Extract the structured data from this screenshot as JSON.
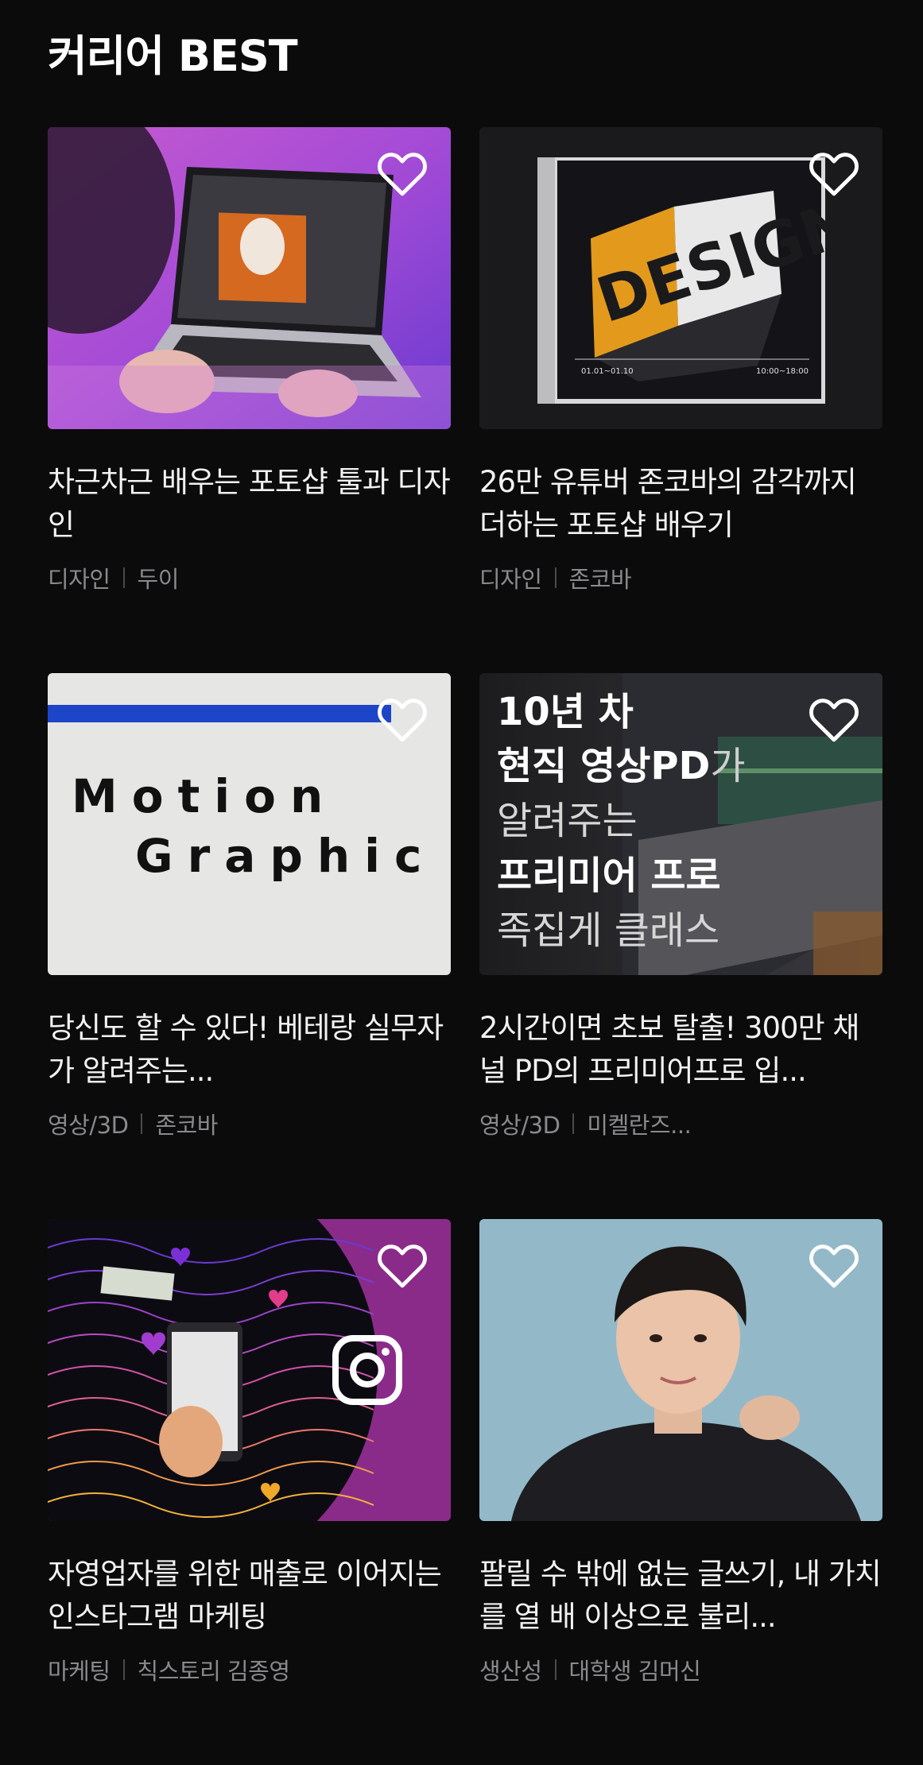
{
  "section": {
    "title": "커리어 BEST"
  },
  "cards": [
    {
      "title": "차근차근 배우는 포토샵 툴과 디자인",
      "category": "디자인",
      "author": "두이",
      "icon": "heart-outline-icon"
    },
    {
      "title": "26만 유튜버 존코바의 감각까지 더하는 포토샵 배우기",
      "category": "디자인",
      "author": "존코바",
      "icon": "heart-outline-icon",
      "cover": {
        "word": "DESIGN",
        "left_text": "01.01~01.10",
        "right_text": "10:00~18:00",
        "accent": "#e39a1c"
      }
    },
    {
      "title": "당신도 할 수 있다! 베테랑 실무자가 알려주는...",
      "category": "영상/3D",
      "author": "존코바",
      "icon": "heart-outline-icon",
      "cover": {
        "line1": "Motion",
        "line2": "Graphic",
        "bar_color": "#1d45c8"
      }
    },
    {
      "title": "2시간이면 초보 탈출! 300만 채널 PD의 프리미어프로 입...",
      "category": "영상/3D",
      "author": "미켈란즈...",
      "icon": "heart-outline-icon",
      "cover": {
        "line1": "10년 차",
        "line2_bold": "현직 영상PD",
        "line2_light": "가",
        "line3": "알려주는",
        "line4": "프리미어 프로",
        "line5": "족집게 클래스"
      }
    },
    {
      "title": "자영업자를 위한 매출로 이어지는 인스타그램 마케팅",
      "category": "마케팅",
      "author": "칙스토리 김종영",
      "icon": "heart-outline-icon",
      "cover": {
        "accent": "#8a2b8a"
      }
    },
    {
      "title": "팔릴 수 밖에 없는 글쓰기, 내 가치를 열 배 이상으로 불리...",
      "category": "생산성",
      "author": "대학생 김머신",
      "icon": "heart-outline-icon",
      "cover": {
        "background": "#93b9c9"
      }
    }
  ]
}
